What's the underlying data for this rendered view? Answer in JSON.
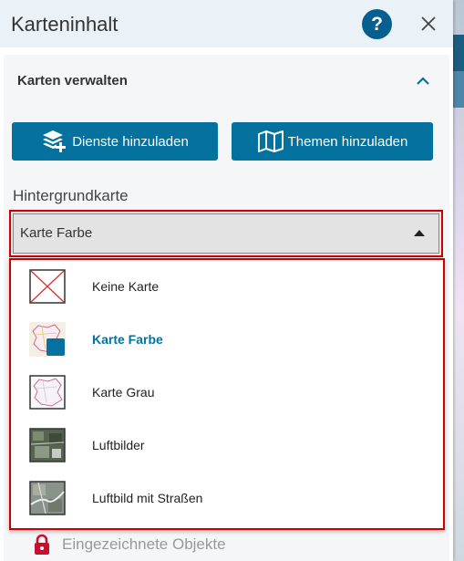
{
  "panel": {
    "title": "Karteninhalt",
    "help_label": "?"
  },
  "section": {
    "title": "Karten verwalten",
    "buttons": {
      "services_label": "Dienste hinzuladen",
      "themes_label": "Themen hinzuladen"
    }
  },
  "background_map": {
    "label": "Hintergrundkarte",
    "selected": "Karte Farbe",
    "options": [
      {
        "label": "Keine Karte",
        "icon": "no-map-icon"
      },
      {
        "label": "Karte Farbe",
        "icon": "color-map-thumbnail"
      },
      {
        "label": "Karte Grau",
        "icon": "gray-map-thumbnail"
      },
      {
        "label": "Luftbilder",
        "icon": "aerial-thumbnail"
      },
      {
        "label": "Luftbild mit Straßen",
        "icon": "aerial-streets-thumbnail"
      }
    ]
  },
  "layers": {
    "drawn_objects_label": "Eingezeichnete Objekte"
  },
  "colors": {
    "accent": "#05719f",
    "help_bg": "#05608f",
    "header_bg": "#eaf2f8",
    "focus_border": "#cc0000",
    "lock": "#c8102e"
  }
}
